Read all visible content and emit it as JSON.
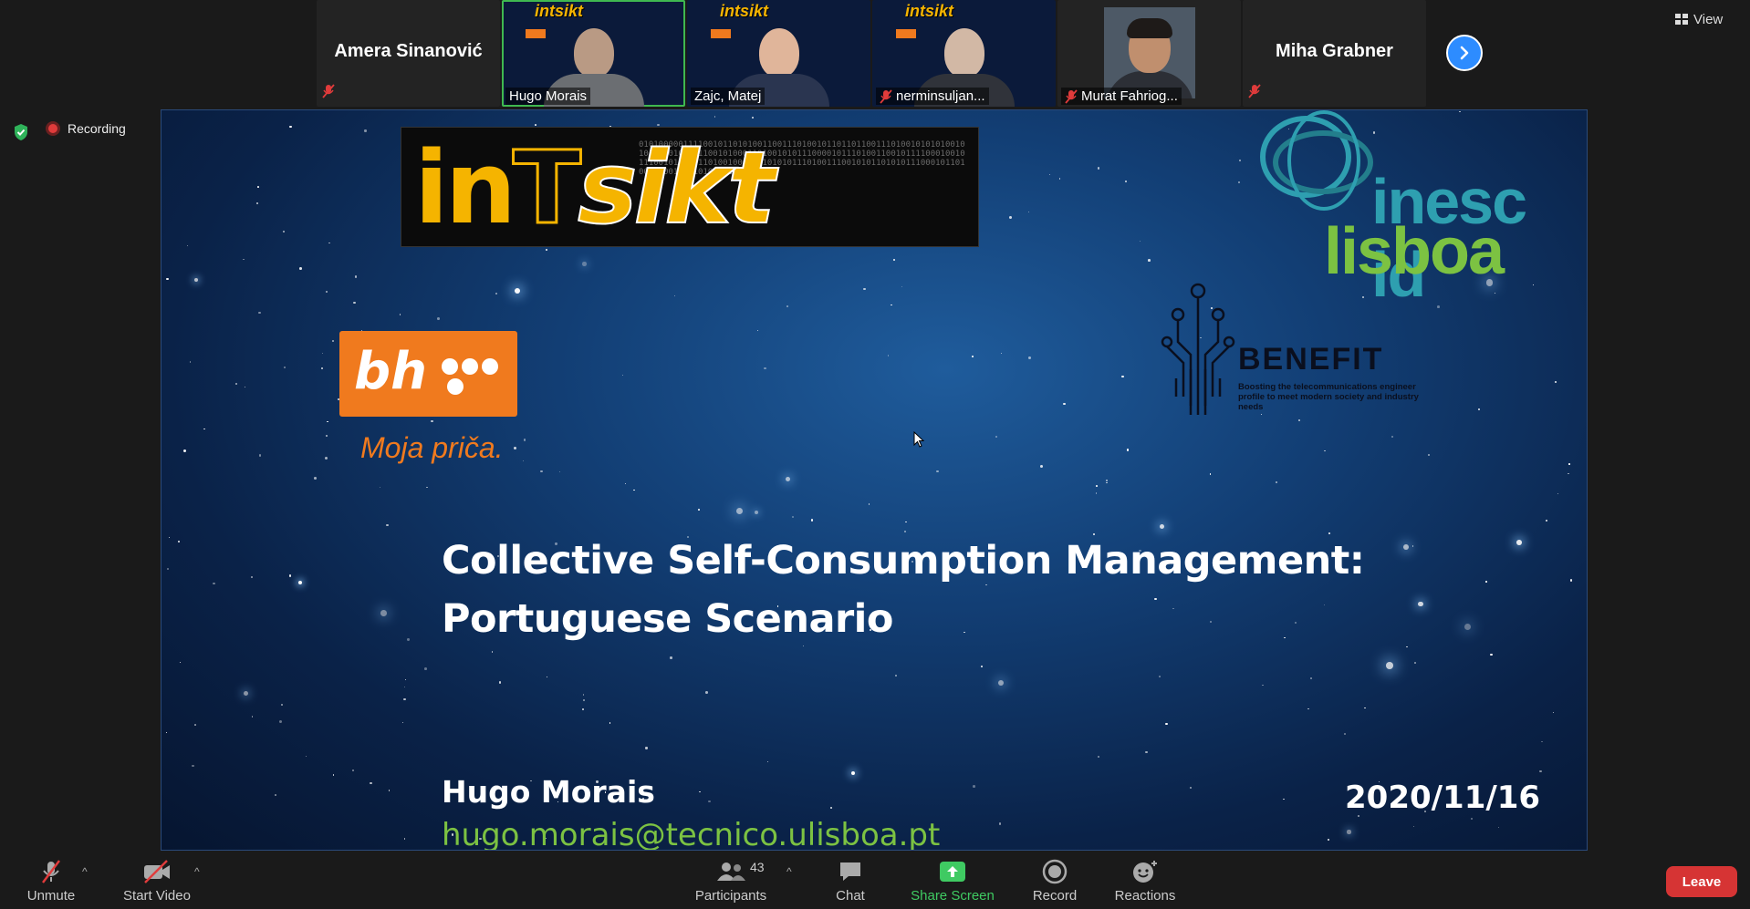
{
  "participants": [
    {
      "name": "Amera Sinanović",
      "type": "name",
      "muted": true
    },
    {
      "name": "Hugo Morais",
      "type": "video",
      "active": true,
      "muted": false
    },
    {
      "name": "Zajc, Matej",
      "type": "video",
      "muted": false
    },
    {
      "name": "nerminsuljan...",
      "type": "video",
      "muted": true
    },
    {
      "name": "Murat Fahriog...",
      "type": "photo",
      "muted": true
    },
    {
      "name": "Miha Grabner",
      "type": "name",
      "muted": true
    }
  ],
  "view_button": {
    "label": "View"
  },
  "status": {
    "recording_label": "Recording"
  },
  "slide": {
    "banner_text": "inTsikt",
    "banner_small": "intsikt",
    "bh_logo_text": "bh",
    "bh_slogan": "Moja priča.",
    "inesc_line1": "inesc id",
    "inesc_line2": "lisboa",
    "benefit_title": "BENEFIT",
    "benefit_subtitle": "Boosting the telecommunications engineer profile to meet modern society and industry needs",
    "title_line1": "Collective Self-Consumption Management:",
    "title_line2": "Portuguese Scenario",
    "author": "Hugo Morais",
    "email": "hugo.morais@tecnico.ulisboa.pt",
    "date": "2020/11/16"
  },
  "toolbar": {
    "unmute": "Unmute",
    "start_video": "Start Video",
    "participants": "Participants",
    "participant_count": "43",
    "chat": "Chat",
    "share_screen": "Share Screen",
    "record": "Record",
    "reactions": "Reactions",
    "leave": "Leave"
  },
  "colors": {
    "accent_blue": "#2d8cff",
    "share_green": "#3fca62",
    "leave_red": "#d63434",
    "bh_orange": "#f07a1e",
    "inesc_teal": "#2e9fb0",
    "lisboa_green": "#7cc242",
    "intsikt_yellow": "#f5b400"
  }
}
